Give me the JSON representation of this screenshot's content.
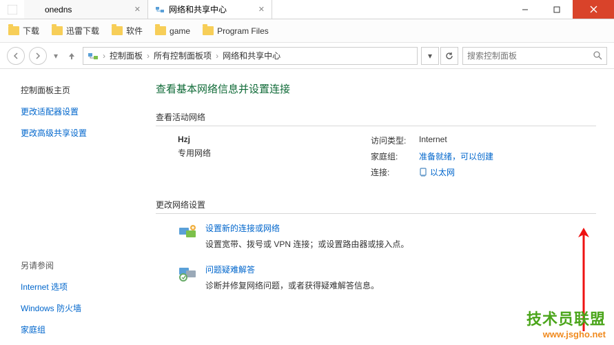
{
  "titlebar": {
    "tabs": [
      {
        "title": "onedns",
        "icon": "folder"
      },
      {
        "title": "网络和共享中心",
        "icon": "network"
      }
    ]
  },
  "bookmarks": [
    {
      "label": "下载"
    },
    {
      "label": "迅雷下载"
    },
    {
      "label": "软件"
    },
    {
      "label": "game"
    },
    {
      "label": "Program Files"
    }
  ],
  "breadcrumb": {
    "items": [
      "控制面板",
      "所有控制面板项",
      "网络和共享中心"
    ]
  },
  "search": {
    "placeholder": "搜索控制面板"
  },
  "sidebar": {
    "home": "控制面板主页",
    "links": [
      "更改适配器设置",
      "更改高级共享设置"
    ],
    "see_also_label": "另请参阅",
    "see_also": [
      "Internet 选项",
      "Windows 防火墙",
      "家庭组"
    ]
  },
  "main": {
    "heading": "查看基本网络信息并设置连接",
    "active_networks_label": "查看活动网络",
    "network": {
      "name": "Hzj",
      "type": "专用网络",
      "access_type_label": "访问类型:",
      "access_type_value": "Internet",
      "homegroup_label": "家庭组:",
      "homegroup_value": "准备就绪，可以创建",
      "connection_label": "连接:",
      "connection_value": "以太网"
    },
    "change_settings_label": "更改网络设置",
    "items": [
      {
        "title": "设置新的连接或网络",
        "desc": "设置宽带、拨号或 VPN 连接；或设置路由器或接入点。"
      },
      {
        "title": "问题疑难解答",
        "desc": "诊断并修复网络问题，或者获得疑难解答信息。"
      }
    ]
  },
  "watermark": {
    "line1": "技术员联盟",
    "line2": "www.jsgho.net"
  }
}
